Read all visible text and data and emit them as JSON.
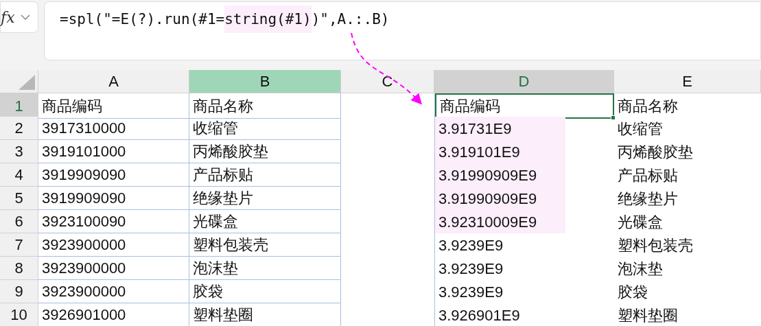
{
  "formula_bar": {
    "function_label": "fx",
    "parts": [
      {
        "text": "=spl(\"=E(?).run(#1=",
        "highlighted": false
      },
      {
        "text": "string(#1)",
        "highlighted": true
      },
      {
        "text": ")\",A.:.B)",
        "highlighted": false
      }
    ]
  },
  "columns": [
    {
      "label": "A",
      "kind": "plain"
    },
    {
      "label": "B",
      "kind": "highlighted"
    },
    {
      "label": "C",
      "kind": "plain"
    },
    {
      "label": "D",
      "kind": "active"
    },
    {
      "label": "E",
      "kind": "plain"
    }
  ],
  "rows": [
    {
      "number": "1",
      "selected": true,
      "code": "商品编码",
      "name": "商品名称",
      "converted": {
        "text": "商品编码",
        "highlighted": false,
        "active": true
      },
      "copy_name": "商品名称"
    },
    {
      "number": "2",
      "selected": false,
      "code": "3917310000",
      "name": "收缩管",
      "converted": {
        "text": "3.91731E9",
        "highlighted": true,
        "active": false
      },
      "copy_name": "收缩管"
    },
    {
      "number": "3",
      "selected": false,
      "code": "3919101000",
      "name": "丙烯酸胶垫",
      "converted": {
        "text": "3.919101E9",
        "highlighted": true,
        "active": false
      },
      "copy_name": "丙烯酸胶垫"
    },
    {
      "number": "4",
      "selected": false,
      "code": "3919909090",
      "name": "产品标贴",
      "converted": {
        "text": "3.91990909E9",
        "highlighted": true,
        "active": false
      },
      "copy_name": "产品标贴"
    },
    {
      "number": "5",
      "selected": false,
      "code": "3919909090",
      "name": "绝缘垫片",
      "converted": {
        "text": "3.91990909E9",
        "highlighted": true,
        "active": false
      },
      "copy_name": "绝缘垫片"
    },
    {
      "number": "6",
      "selected": false,
      "code": "3923100090",
      "name": "光碟盒",
      "converted": {
        "text": "3.92310009E9",
        "highlighted": true,
        "active": false
      },
      "copy_name": "光碟盒"
    },
    {
      "number": "7",
      "selected": false,
      "code": "3923900000",
      "name": "塑料包装壳",
      "converted": {
        "text": "3.9239E9",
        "highlighted": false,
        "active": false
      },
      "copy_name": "塑料包装壳"
    },
    {
      "number": "8",
      "selected": false,
      "code": "3923900000",
      "name": "泡沫垫",
      "converted": {
        "text": "3.9239E9",
        "highlighted": false,
        "active": false
      },
      "copy_name": "泡沫垫"
    },
    {
      "number": "9",
      "selected": false,
      "code": "3923900000",
      "name": "胶袋",
      "converted": {
        "text": "3.9239E9",
        "highlighted": false,
        "active": false
      },
      "copy_name": "胶袋"
    },
    {
      "number": "10",
      "selected": false,
      "code": "3926901000",
      "name": "塑料垫圈",
      "converted": {
        "text": "3.926901E9",
        "highlighted": false,
        "active": false
      },
      "copy_name": "塑料垫圈"
    }
  ]
}
